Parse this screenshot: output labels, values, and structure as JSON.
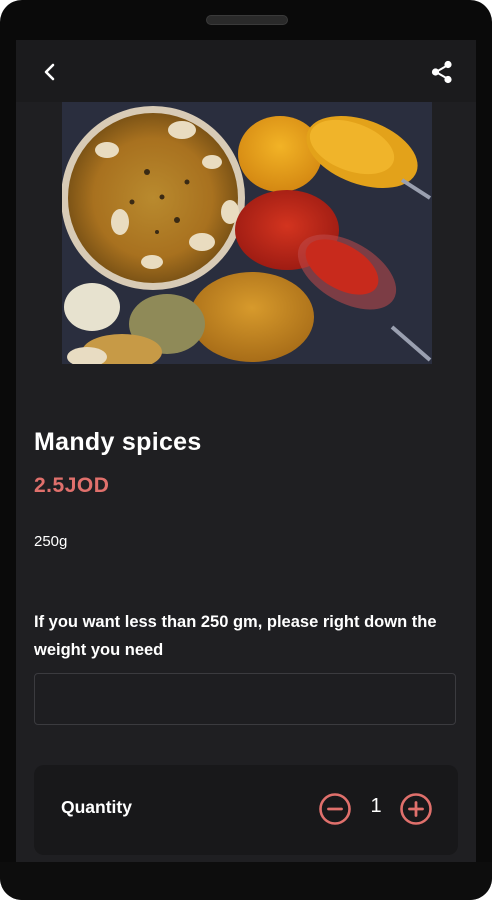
{
  "header": {
    "back_icon": "back-arrow-icon",
    "share_icon": "share-icon"
  },
  "product": {
    "image_description_icon": "product-photo",
    "name": "Mandy spices",
    "price": "2.5JOD",
    "weight": "250g",
    "note": "If you want less than 250 gm, please right down the weight you need"
  },
  "weight_input": {
    "value": "",
    "placeholder": ""
  },
  "quantity": {
    "label": "Quantity",
    "value": "1",
    "minus_icon": "minus-circle-icon",
    "plus_icon": "plus-circle-icon"
  },
  "colors": {
    "accent": "#e0706c",
    "background": "#1f1f22",
    "card": "#18181a"
  }
}
